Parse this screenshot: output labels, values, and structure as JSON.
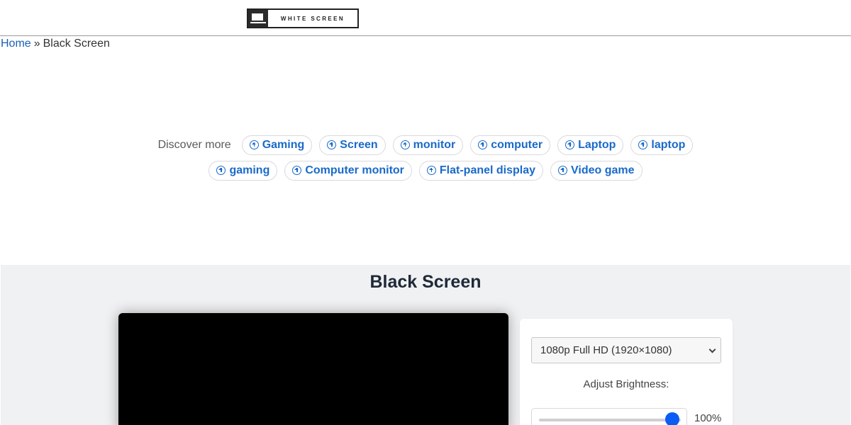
{
  "header": {
    "logo_text": "WHITE SCREEN"
  },
  "breadcrumb": {
    "home": "Home",
    "separator": "»",
    "current": "Black Screen"
  },
  "discover": {
    "label": "Discover more",
    "row1": [
      "Gaming",
      "Screen",
      "monitor",
      "computer",
      "Laptop",
      "laptop"
    ],
    "row2": [
      "gaming",
      "Computer monitor",
      "Flat-panel display",
      "Video game"
    ]
  },
  "main": {
    "title": "Black Screen",
    "resolution_selected": "1080p Full HD (1920×1080)",
    "brightness_label": "Adjust Brightness:",
    "brightness_value": "100%",
    "brightness_fraction": 1.0
  },
  "colors": {
    "link": "#1a5fb4",
    "chip_text": "#1a6ac9",
    "slider_thumb": "#0a5cf5",
    "panel_bg": "#f0f1f3"
  }
}
